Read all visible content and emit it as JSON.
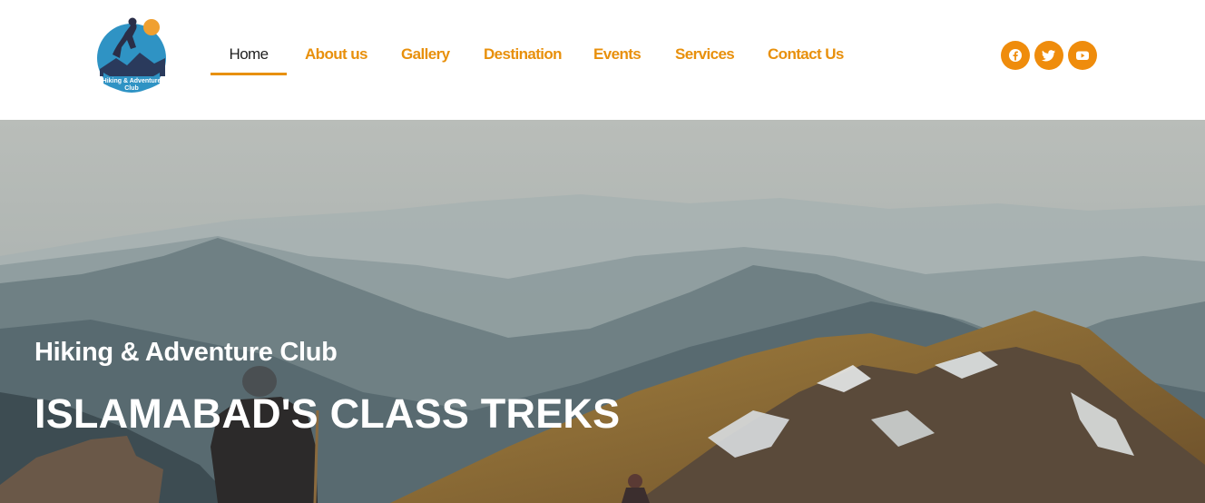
{
  "logo": {
    "text_line1": "Hiking & Adventure",
    "text_line2": "Club"
  },
  "nav": {
    "items": [
      {
        "label": "Home",
        "active": true
      },
      {
        "label": "About us",
        "active": false
      },
      {
        "label": "Gallery",
        "active": false
      },
      {
        "label": "Destination",
        "active": false
      },
      {
        "label": "Events",
        "active": false
      },
      {
        "label": "Services",
        "active": false
      },
      {
        "label": "Contact Us",
        "active": false
      }
    ]
  },
  "social": [
    {
      "icon": "facebook-icon"
    },
    {
      "icon": "twitter-icon"
    },
    {
      "icon": "youtube-icon"
    }
  ],
  "hero": {
    "subtitle": "Hiking & Adventure Club",
    "title": "ISLAMABAD'S CLASS TREKS"
  },
  "colors": {
    "accent": "#e8900c",
    "nav_active": "#1f1f1f",
    "hero_text": "#ffffff"
  }
}
